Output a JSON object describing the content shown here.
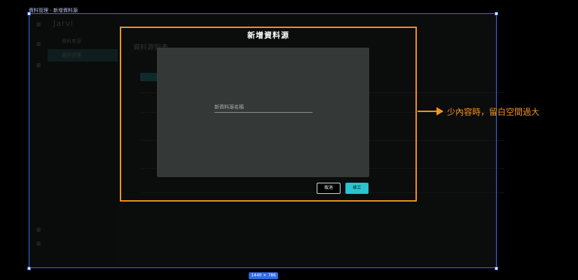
{
  "frame": {
    "label": "資料管理 - 新增資料源",
    "size_badge": "1440 × 786"
  },
  "app": {
    "logo": "Jarvi",
    "sidebar": {
      "items": [
        {
          "label": "資料來源"
        },
        {
          "label": "資料管理"
        }
      ]
    },
    "page_title": "資料源列表"
  },
  "dialog": {
    "title": "新增資料源",
    "name_field_placeholder": "新資料源名稱",
    "cancel_label": "取消",
    "confirm_label": "確立"
  },
  "annotation": {
    "note": "少內容時，留白空間過大",
    "color": "#f39224"
  },
  "colors": {
    "accent": "#28c4cf",
    "selection": "#3b6fe6"
  }
}
